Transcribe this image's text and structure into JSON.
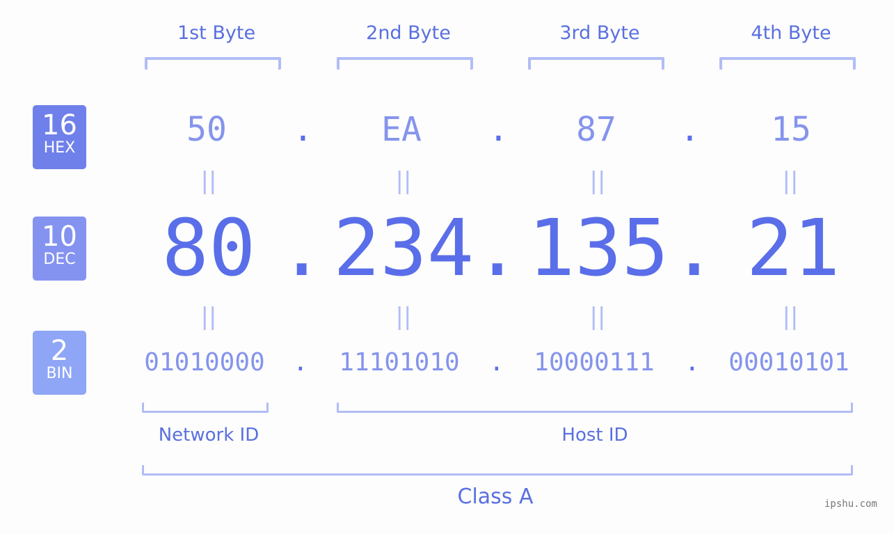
{
  "bytes": {
    "labels": [
      "1st Byte",
      "2nd Byte",
      "3rd Byte",
      "4th Byte"
    ]
  },
  "bases": {
    "hex": {
      "num": "16",
      "label": "HEX"
    },
    "dec": {
      "num": "10",
      "label": "DEC"
    },
    "bin": {
      "num": "2",
      "label": "BIN"
    }
  },
  "ip": {
    "hex": [
      "50",
      "EA",
      "87",
      "15"
    ],
    "dec": [
      "80",
      "234",
      "135",
      "21"
    ],
    "bin": [
      "01010000",
      "11101010",
      "10000111",
      "00010101"
    ],
    "separator": ".",
    "equals": "||"
  },
  "sections": {
    "network": "Network ID",
    "host": "Host ID",
    "class": "Class A"
  },
  "watermark": "ipshu.com",
  "colors": {
    "primary": "#5a6ee9",
    "light": "#8594ec",
    "bracket": "#b2bcf6"
  }
}
